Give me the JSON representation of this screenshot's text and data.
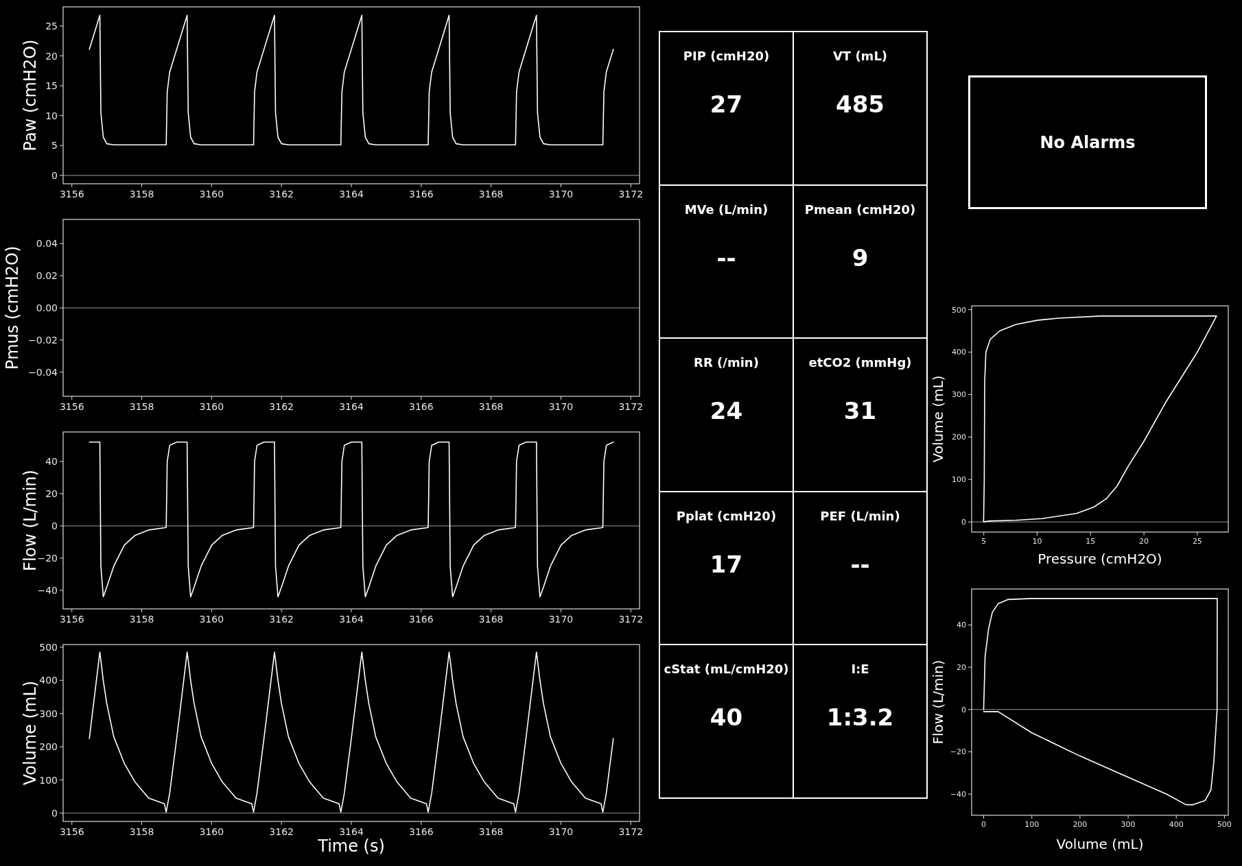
{
  "waveforms": [
    {
      "chart_data": {
        "type": "line",
        "ylabel": "Paw (cmH2O)",
        "xlim": [
          3155.75,
          3172.25
        ],
        "ylim": [
          -1.4,
          28.2
        ],
        "xticks": [
          3156,
          3158,
          3160,
          3162,
          3164,
          3166,
          3168,
          3170,
          3172
        ],
        "yticks": [
          0,
          5,
          10,
          15,
          20,
          25
        ],
        "ref_lines": [
          {
            "axis": "y",
            "value": 0
          }
        ],
        "x": [
          3156.5,
          3156.8,
          3156.83,
          3156.9,
          3157.0,
          3157.2,
          3157.5,
          3157.8,
          3158.2,
          3158.65,
          3158.7,
          3158.73,
          3158.8,
          3159.0,
          3159.3,
          3159.33,
          3159.4,
          3159.5,
          3159.7,
          3160.0,
          3160.3,
          3160.7,
          3161.15,
          3161.2,
          3161.23,
          3161.3,
          3161.5,
          3161.8,
          3161.83,
          3161.9,
          3162.0,
          3162.2,
          3162.5,
          3162.8,
          3163.2,
          3163.65,
          3163.7,
          3163.73,
          3163.8,
          3164.0,
          3164.3,
          3164.33,
          3164.4,
          3164.5,
          3164.7,
          3165.0,
          3165.3,
          3165.7,
          3166.15,
          3166.2,
          3166.23,
          3166.3,
          3166.5,
          3166.8,
          3166.83,
          3166.9,
          3167.0,
          3167.2,
          3167.5,
          3167.8,
          3168.2,
          3168.65,
          3168.7,
          3168.73,
          3168.8,
          3169.0,
          3169.3,
          3169.33,
          3169.4,
          3169.5,
          3169.7,
          3170.0,
          3170.3,
          3170.7,
          3171.15,
          3171.2,
          3171.23,
          3171.3,
          3171.5
        ],
        "series": [
          {
            "color": "#ffffff",
            "values": [
              21.1,
              26.8,
              10.5,
              6.4,
              5.3,
              5.1,
              5.1,
              5.1,
              5.1,
              5.1,
              5.1,
              14,
              17.3,
              21.1,
              26.8,
              10.5,
              6.4,
              5.3,
              5.1,
              5.1,
              5.1,
              5.1,
              5.1,
              5.1,
              14,
              17.3,
              21.1,
              26.8,
              10.5,
              6.4,
              5.3,
              5.1,
              5.1,
              5.1,
              5.1,
              5.1,
              5.1,
              14,
              17.3,
              21.1,
              26.8,
              10.5,
              6.4,
              5.3,
              5.1,
              5.1,
              5.1,
              5.1,
              5.1,
              5.1,
              14,
              17.3,
              21.1,
              26.8,
              10.5,
              6.4,
              5.3,
              5.1,
              5.1,
              5.1,
              5.1,
              5.1,
              5.1,
              14,
              17.3,
              21.1,
              26.8,
              10.5,
              6.4,
              5.3,
              5.1,
              5.1,
              5.1,
              5.1,
              5.1,
              5.1,
              14,
              17.3,
              21.1
            ]
          }
        ]
      }
    },
    {
      "chart_data": {
        "type": "line",
        "ylabel": "Pmus (cmH2O)",
        "xlim": [
          3155.75,
          3172.25
        ],
        "ylim": [
          -0.055,
          0.055
        ],
        "xticks": [
          3156,
          3158,
          3160,
          3162,
          3164,
          3166,
          3168,
          3170,
          3172
        ],
        "yticks": [
          {
            "value": -0.04,
            "label": "−0.04"
          },
          {
            "value": -0.02,
            "label": "−0.02"
          },
          {
            "value": 0,
            "label": "0.00"
          },
          {
            "value": 0.02,
            "label": "0.02"
          },
          {
            "value": 0.04,
            "label": "0.04"
          }
        ],
        "ref_lines": [
          {
            "axis": "y",
            "value": 0
          }
        ]
      }
    },
    {
      "chart_data": {
        "type": "line",
        "ylabel": "Flow (L/min)",
        "xlim": [
          3155.75,
          3172.25
        ],
        "ylim": [
          -51.5,
          58.3
        ],
        "xticks": [
          3156,
          3158,
          3160,
          3162,
          3164,
          3166,
          3168,
          3170,
          3172
        ],
        "yticks": [
          {
            "value": -40,
            "label": "−40"
          },
          {
            "value": -20,
            "label": "−20"
          },
          0,
          20,
          40
        ],
        "ref_lines": [
          {
            "axis": "y",
            "value": 0
          }
        ],
        "x": [
          3156.5,
          3156.8,
          3156.83,
          3156.9,
          3157.0,
          3157.2,
          3157.5,
          3157.8,
          3158.2,
          3158.65,
          3158.7,
          3158.73,
          3158.8,
          3159.0,
          3159.3,
          3159.33,
          3159.4,
          3159.5,
          3159.7,
          3160.0,
          3160.3,
          3160.7,
          3161.15,
          3161.2,
          3161.23,
          3161.3,
          3161.5,
          3161.8,
          3161.83,
          3161.9,
          3162.0,
          3162.2,
          3162.5,
          3162.8,
          3163.2,
          3163.65,
          3163.7,
          3163.73,
          3163.8,
          3164.0,
          3164.3,
          3164.33,
          3164.4,
          3164.5,
          3164.7,
          3165.0,
          3165.3,
          3165.7,
          3166.15,
          3166.2,
          3166.23,
          3166.3,
          3166.5,
          3166.8,
          3166.83,
          3166.9,
          3167.0,
          3167.2,
          3167.5,
          3167.8,
          3168.2,
          3168.65,
          3168.7,
          3168.73,
          3168.8,
          3169.0,
          3169.3,
          3169.33,
          3169.4,
          3169.5,
          3169.7,
          3170.0,
          3170.3,
          3170.7,
          3171.15,
          3171.2,
          3171.23,
          3171.3,
          3171.5
        ],
        "series": [
          {
            "color": "#ffffff",
            "values": [
              52,
              52,
              -25,
              -44,
              -38,
              -25,
              -12,
              -6,
              -2.5,
              -1.2,
              -1,
              40,
              50,
              52,
              52,
              -25,
              -44,
              -38,
              -25,
              -12,
              -6,
              -2.5,
              -1.2,
              -1,
              40,
              50,
              52,
              52,
              -25,
              -44,
              -38,
              -25,
              -12,
              -6,
              -2.5,
              -1.2,
              -1,
              40,
              50,
              52,
              52,
              -25,
              -44,
              -38,
              -25,
              -12,
              -6,
              -2.5,
              -1.2,
              -1,
              40,
              50,
              52,
              52,
              -25,
              -44,
              -38,
              -25,
              -12,
              -6,
              -2.5,
              -1.2,
              -1,
              40,
              50,
              52,
              52,
              -25,
              -44,
              -38,
              -25,
              -12,
              -6,
              -2.5,
              -1.2,
              -1,
              40,
              50,
              52
            ]
          }
        ]
      }
    },
    {
      "chart_data": {
        "type": "line",
        "xlabel": "Time (s)",
        "ylabel": "Volume (mL)",
        "xlim": [
          3155.75,
          3172.25
        ],
        "ylim": [
          -25,
          508
        ],
        "xticks": [
          3156,
          3158,
          3160,
          3162,
          3164,
          3166,
          3168,
          3170,
          3172
        ],
        "yticks": [
          0,
          100,
          200,
          300,
          400,
          500
        ],
        "ref_lines": [
          {
            "axis": "y",
            "value": 0
          }
        ],
        "x": [
          3156.5,
          3156.8,
          3156.83,
          3156.9,
          3157.0,
          3157.2,
          3157.5,
          3157.8,
          3158.2,
          3158.65,
          3158.7,
          3158.73,
          3158.8,
          3159.0,
          3159.3,
          3159.33,
          3159.4,
          3159.5,
          3159.7,
          3160.0,
          3160.3,
          3160.7,
          3161.15,
          3161.2,
          3161.23,
          3161.3,
          3161.5,
          3161.8,
          3161.83,
          3161.9,
          3162.0,
          3162.2,
          3162.5,
          3162.8,
          3163.2,
          3163.65,
          3163.7,
          3163.73,
          3163.8,
          3164.0,
          3164.3,
          3164.33,
          3164.4,
          3164.5,
          3164.7,
          3165.0,
          3165.3,
          3165.7,
          3166.15,
          3166.2,
          3166.23,
          3166.3,
          3166.5,
          3166.8,
          3166.83,
          3166.9,
          3167.0,
          3167.2,
          3167.5,
          3167.8,
          3168.2,
          3168.65,
          3168.7,
          3168.73,
          3168.8,
          3169.0,
          3169.3,
          3169.33,
          3169.4,
          3169.5,
          3169.7,
          3170.0,
          3170.3,
          3170.7,
          3171.15,
          3171.2,
          3171.23,
          3171.3,
          3171.5
        ],
        "series": [
          {
            "color": "#ffffff",
            "values": [
              225,
              485,
              460,
              400,
              330,
              230,
              150,
              95,
              45,
              28,
              3,
              20,
              60,
              225,
              485,
              460,
              400,
              330,
              230,
              150,
              95,
              45,
              28,
              3,
              20,
              60,
              225,
              485,
              460,
              400,
              330,
              230,
              150,
              95,
              45,
              28,
              3,
              20,
              60,
              225,
              485,
              460,
              400,
              330,
              230,
              150,
              95,
              45,
              28,
              3,
              20,
              60,
              225,
              485,
              460,
              400,
              330,
              230,
              150,
              95,
              45,
              28,
              3,
              20,
              60,
              225,
              485,
              460,
              400,
              330,
              230,
              150,
              95,
              45,
              28,
              3,
              20,
              60,
              225
            ]
          }
        ]
      }
    }
  ],
  "metrics": [
    {
      "label": "PIP (cmH20)",
      "value": "27"
    },
    {
      "label": "VT (mL)",
      "value": "485"
    },
    {
      "label": "MVe (L/min)",
      "value": "--"
    },
    {
      "label": "Pmean (cmH20)",
      "value": "9"
    },
    {
      "label": "RR (/min)",
      "value": "24"
    },
    {
      "label": "etCO2 (mmHg)",
      "value": "31"
    },
    {
      "label": "Pplat (cmH20)",
      "value": "17"
    },
    {
      "label": "PEF (L/min)",
      "value": "--"
    },
    {
      "label": "cStat (mL/cmH20)",
      "value": "40"
    },
    {
      "label": "I:E",
      "value": "1:3.2"
    }
  ],
  "alarm_status": {
    "text": "No Alarms"
  },
  "loops": [
    {
      "chart_data": {
        "type": "line",
        "xlabel": "Pressure (cmH2O)",
        "ylabel": "Volume (mL)",
        "xlim": [
          3.86,
          27.9
        ],
        "ylim": [
          -24,
          509
        ],
        "xticks": [
          5,
          10,
          15,
          20,
          25
        ],
        "yticks": [
          0,
          100,
          200,
          300,
          400,
          500
        ],
        "ref_lines": [
          {
            "axis": "y",
            "value": 0
          }
        ],
        "series": [
          {
            "color": "#ffffff",
            "x": [
              5.0,
              5.5,
              8,
              10.5,
              13.7,
              15.3,
              16.5,
              17.5,
              18.5,
              20,
              22,
              25,
              26.8,
              16,
              12,
              10,
              8,
              6.5,
              5.6,
              5.2,
              5.08,
              5.04,
              4.98
            ],
            "values": [
              0,
              2,
              4,
              8,
              20,
              35,
              55,
              85,
              130,
              190,
              280,
              400,
              485,
              485,
              480,
              475,
              465,
              450,
              430,
              400,
              330,
              100,
              1
            ]
          }
        ]
      }
    },
    {
      "chart_data": {
        "type": "line",
        "xlabel": "Volume (mL)",
        "ylabel": "Flow (L/min)",
        "xlim": [
          -25,
          508
        ],
        "ylim": [
          -50,
          57
        ],
        "xticks": [
          0,
          100,
          200,
          300,
          400,
          500
        ],
        "yticks": [
          {
            "value": -40,
            "label": "−40"
          },
          {
            "value": -20,
            "label": "−20"
          },
          0,
          20,
          40
        ],
        "ref_lines": [
          {
            "axis": "y",
            "value": 0
          }
        ],
        "series": [
          {
            "color": "#ffffff",
            "x": [
              0,
              3,
              10,
              18,
              30,
              50,
              100,
              485,
              484.8,
              482,
              478,
              472,
              460,
              435,
              420,
              380,
              300,
              200,
              100,
              30,
              0
            ],
            "values": [
              0,
              25,
              38,
              46,
              50,
              52,
              52.5,
              52.5,
              0,
              -10,
              -25,
              -38,
              -43,
              -45,
              -45,
              -40,
              -32,
              -22,
              -11,
              -1,
              -1
            ]
          }
        ]
      }
    }
  ]
}
